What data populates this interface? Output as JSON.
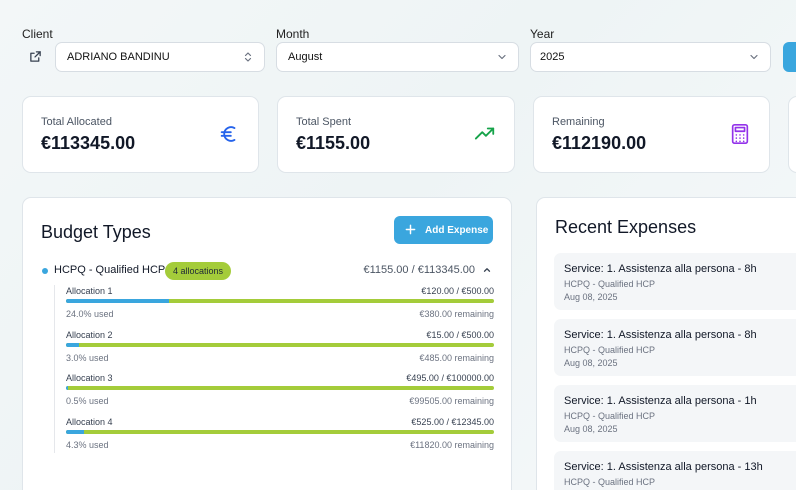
{
  "filters": {
    "client": {
      "label": "Client",
      "value": "ADRIANO BANDINU"
    },
    "month": {
      "label": "Month",
      "value": "August"
    },
    "year": {
      "label": "Year",
      "value": "2025"
    }
  },
  "stats": [
    {
      "label": "Total Allocated",
      "value": "€113345.00",
      "icon": "euro-icon",
      "color": "#2563eb"
    },
    {
      "label": "Total Spent",
      "value": "€1155.00",
      "icon": "trending-up-icon",
      "color": "#16a34a"
    },
    {
      "label": "Remaining",
      "value": "€112190.00",
      "icon": "calculator-icon",
      "color": "#9333ea"
    }
  ],
  "budget": {
    "title": "Budget Types",
    "add_label": "Add Expense",
    "type_name": "HCPQ - Qualified HCP",
    "badge": "4 allocations",
    "total": "€1155.00 / €113345.00",
    "allocations": [
      {
        "name": "Allocation 1",
        "amount": "€120.00 / €500.00",
        "used": "24.0% used",
        "remaining": "€380.00 remaining",
        "pct": 24.0
      },
      {
        "name": "Allocation 2",
        "amount": "€15.00 / €500.00",
        "used": "3.0% used",
        "remaining": "€485.00 remaining",
        "pct": 3.0
      },
      {
        "name": "Allocation 3",
        "amount": "€495.00 / €100000.00",
        "used": "0.5% used",
        "remaining": "€99505.00 remaining",
        "pct": 0.5
      },
      {
        "name": "Allocation 4",
        "amount": "€525.00 / €12345.00",
        "used": "4.3% used",
        "remaining": "€11820.00 remaining",
        "pct": 4.3
      }
    ]
  },
  "recent": {
    "title": "Recent Expenses",
    "items": [
      {
        "title": "Service: 1. Assistenza alla persona - 8h",
        "category": "HCPQ - Qualified HCP",
        "date": "Aug 08, 2025"
      },
      {
        "title": "Service: 1. Assistenza alla persona - 8h",
        "category": "HCPQ - Qualified HCP",
        "date": "Aug 08, 2025"
      },
      {
        "title": "Service: 1. Assistenza alla persona - 1h",
        "category": "HCPQ - Qualified HCP",
        "date": "Aug 08, 2025"
      },
      {
        "title": "Service: 1. Assistenza alla persona - 13h",
        "category": "HCPQ - Qualified HCP",
        "date": ""
      }
    ]
  }
}
